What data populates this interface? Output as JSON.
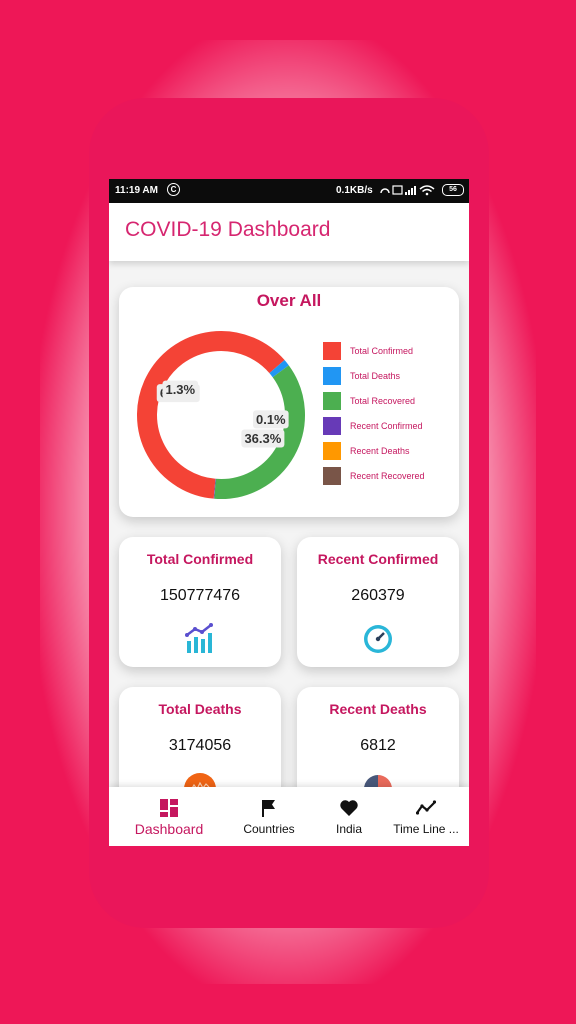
{
  "status_bar": {
    "time": "11:19 AM",
    "c_glyph": "C",
    "net_speed": "0.1KB/s",
    "battery": "56"
  },
  "app_bar": {
    "title": "COVID-19 Dashboard"
  },
  "overall": {
    "title": "Over All",
    "chart_data": {
      "type": "pie",
      "slices": [
        {
          "label": "Total Confirmed",
          "percent": 62.2,
          "display": "62.2%",
          "color": "#f44336"
        },
        {
          "label": "Total Deaths",
          "percent": 1.3,
          "display": "1.3%",
          "color": "#2196f3"
        },
        {
          "label": "Total Recovered",
          "percent": 36.3,
          "display": "36.3%",
          "color": "#4caf50"
        },
        {
          "label": "Recent Confirmed",
          "percent": 0.1,
          "display": "0.1%",
          "color": "#673ab7"
        },
        {
          "label": "Recent Deaths",
          "percent": 0.0,
          "display": "",
          "color": "#ff9800"
        },
        {
          "label": "Recent Recovered",
          "percent": 0.0,
          "display": "",
          "color": "#795548"
        }
      ]
    },
    "legend": [
      {
        "label": "Total Confirmed",
        "color": "#f44336"
      },
      {
        "label": "Total Deaths",
        "color": "#2196f3"
      },
      {
        "label": "Total Recovered",
        "color": "#4caf50"
      },
      {
        "label": "Recent Confirmed",
        "color": "#673ab7"
      },
      {
        "label": "Recent Deaths",
        "color": "#ff9800"
      },
      {
        "label": "Recent Recovered",
        "color": "#795548"
      }
    ]
  },
  "stats": [
    {
      "title": "Total Confirmed",
      "value": "150777476",
      "icon": "bar-chart-icon"
    },
    {
      "title": "Recent Confirmed",
      "value": "260379",
      "icon": "speedometer-icon"
    },
    {
      "title": "Total Deaths",
      "value": "3174056",
      "icon": "orange-chart-icon"
    },
    {
      "title": "Recent Deaths",
      "value": "6812",
      "icon": "pie-chart-icon"
    }
  ],
  "bottom_nav": [
    {
      "label": "Dashboard",
      "icon": "dashboard-icon",
      "active": true
    },
    {
      "label": "Countries",
      "icon": "flag-icon",
      "active": false
    },
    {
      "label": "India",
      "icon": "heart-icon",
      "active": false
    },
    {
      "label": "Time Line ...",
      "icon": "timeline-icon",
      "active": false
    }
  ],
  "colors": {
    "background": "#ee1757",
    "phone": "#ea165a",
    "accent": "#c5175f",
    "title": "#d62670"
  }
}
